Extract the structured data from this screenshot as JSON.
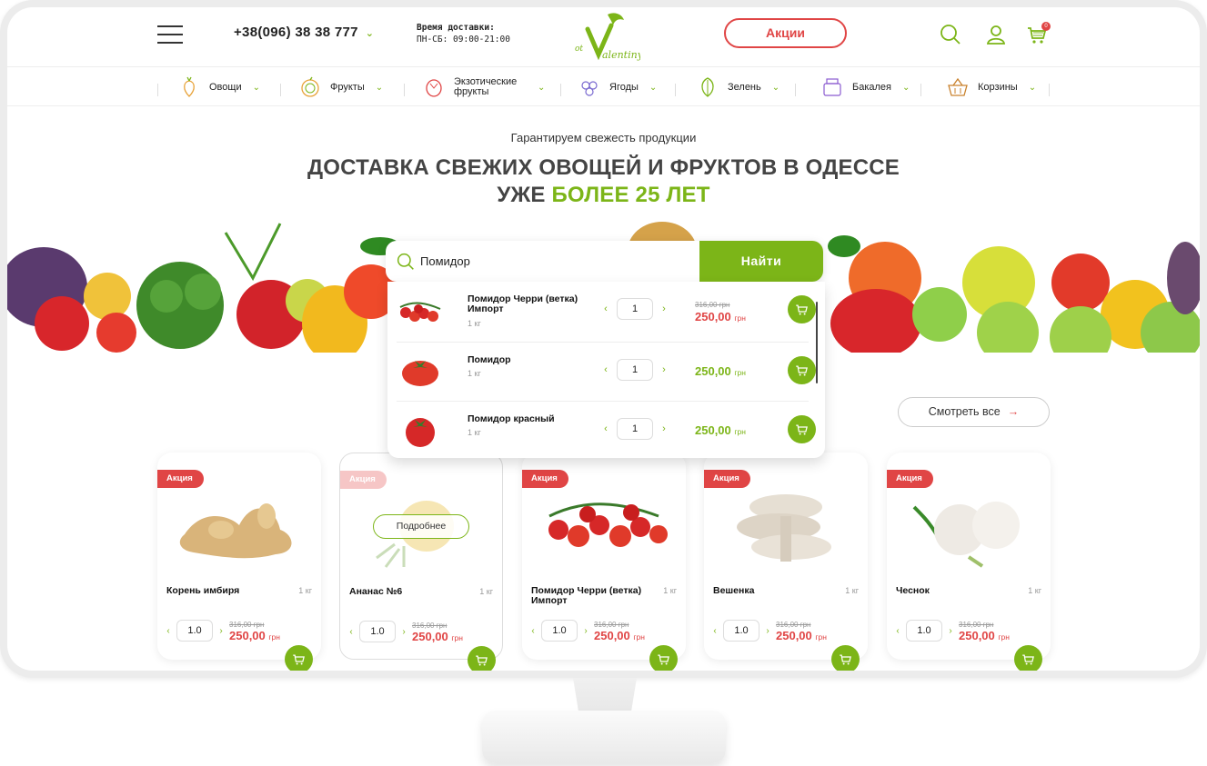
{
  "header": {
    "phone": "+38(096) 38 38 777",
    "delivery_title": "Время доставки:",
    "delivery_hours": "ПН-СБ: 09:00-21:00",
    "logo_text": "ot Valentiny",
    "promo_label": "Акции",
    "cart_count": "0"
  },
  "categories": [
    {
      "label": "Овощи",
      "icon": "carrot-icon"
    },
    {
      "label": "Фрукты",
      "icon": "citrus-icon"
    },
    {
      "label": "Экзотические фрукты",
      "icon": "pitaya-icon"
    },
    {
      "label": "Ягоды",
      "icon": "berries-icon"
    },
    {
      "label": "Зелень",
      "icon": "greens-icon"
    },
    {
      "label": "Бакалея",
      "icon": "grocery-icon"
    },
    {
      "label": "Корзины",
      "icon": "basket-icon"
    }
  ],
  "hero": {
    "subtitle": "Гарантируем свежесть продукции",
    "title_line1": "ДОСТАВКА СВЕЖИХ ОВОЩЕЙ И ФРУКТОВ В ОДЕССЕ",
    "title_line2_prefix": "УЖЕ ",
    "title_line2_highlight": "БОЛЕЕ 25 ЛЕТ"
  },
  "search": {
    "value": "Помидор",
    "button_label": "Найти",
    "results": [
      {
        "name": "Помидор Черри (ветка) Импорт",
        "unit": "1 кг",
        "qty": "1",
        "old_price": "316,00 грн",
        "price": "250,00",
        "currency": "грн",
        "sale": true
      },
      {
        "name": "Помидор",
        "unit": "1 кг",
        "qty": "1",
        "old_price": "",
        "price": "250,00",
        "currency": "грн",
        "sale": false
      },
      {
        "name": "Помидор красный",
        "unit": "1 кг",
        "qty": "1",
        "old_price": "",
        "price": "250,00",
        "currency": "грн",
        "sale": false
      }
    ]
  },
  "see_all": {
    "label": "Смотреть все",
    "arrow": "→"
  },
  "products": [
    {
      "badge": "Акция",
      "name": "Корень имбиря",
      "unit": "1 кг",
      "qty": "1.0",
      "old_price": "316,00 грн",
      "price": "250,00",
      "currency": "грн"
    },
    {
      "badge": "Акция",
      "name": "Ананас №6",
      "unit": "1 кг",
      "qty": "1.0",
      "old_price": "316,00 грн",
      "price": "250,00",
      "currency": "грн",
      "hover_label": "Подробнее"
    },
    {
      "badge": "Акция",
      "name": "Помидор Черри (ветка) Импорт",
      "unit": "1 кг",
      "qty": "1.0",
      "old_price": "316,00 грн",
      "price": "250,00",
      "currency": "грн"
    },
    {
      "badge": "Акция",
      "name": "Вешенка",
      "unit": "1 кг",
      "qty": "1.0",
      "old_price": "316,00 грн",
      "price": "250,00",
      "currency": "грн"
    },
    {
      "badge": "Акция",
      "name": "Чеснок",
      "unit": "1 кг",
      "qty": "1.0",
      "old_price": "316,00 грн",
      "price": "250,00",
      "currency": "грн"
    }
  ],
  "colors": {
    "accent": "#7cb518",
    "sale": "#e04545",
    "text": "#222222"
  }
}
